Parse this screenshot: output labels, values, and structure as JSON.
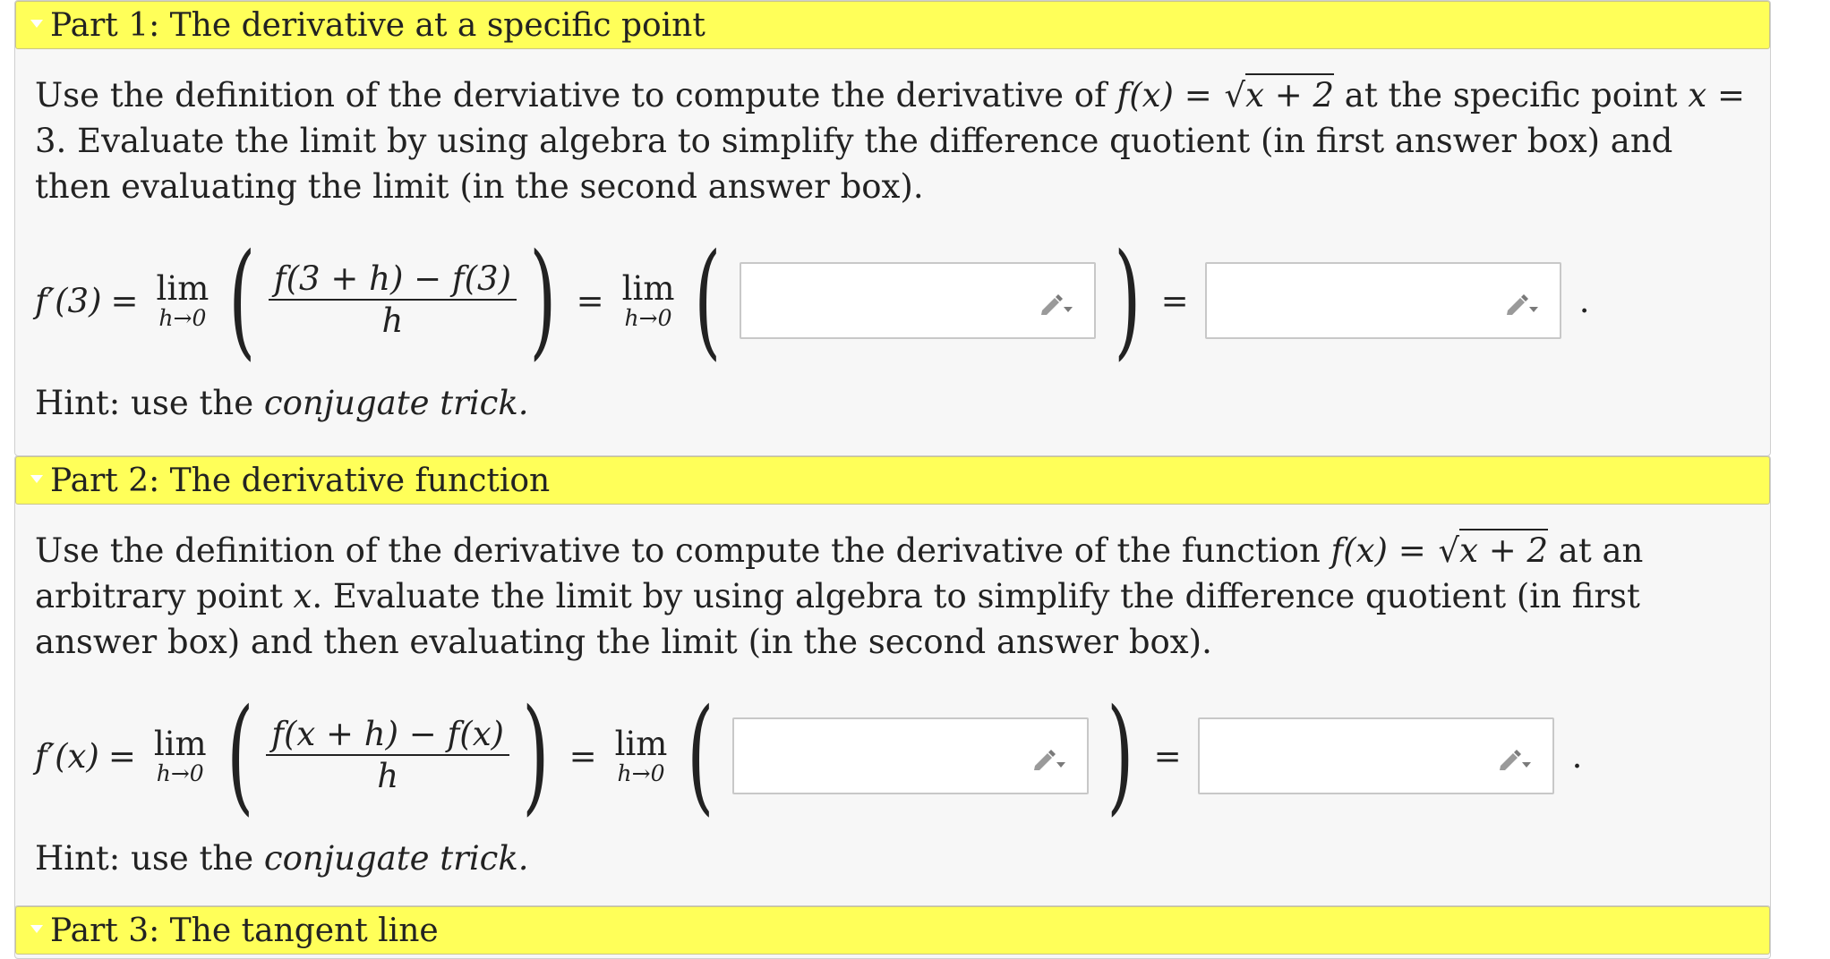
{
  "part1": {
    "title": "Part 1: The derivative at a specific point",
    "prompt_a": "Use the definition of the derviative to compute the derivative of ",
    "func_lhs": "f(x)",
    "func_eq": " = ",
    "func_sqrt": "x + 2",
    "prompt_b": " at the specific point ",
    "point_var": "x",
    "point_eq": " = ",
    "point_val": "3",
    "prompt_c": ". Evaluate the limit by using algebra to simplify the difference quotient (in first answer box) and then evaluating the limit (in the second answer box).",
    "eq_lhs": "f′(3)",
    "eq_equals": "=",
    "lim_word": "lim",
    "lim_sub": "h→0",
    "frac_num": "f(3 + h) − f(3)",
    "frac_den": "h",
    "answer1_value": "",
    "answer2_value": "",
    "trailing": ".",
    "hint_prefix": "Hint: use the ",
    "hint_em": "conjugate trick."
  },
  "part2": {
    "title": "Part 2: The derivative function",
    "prompt_a": "Use the definition of the derivative to compute the derivative of the function ",
    "func_lhs": "f(x)",
    "func_eq": " = ",
    "func_sqrt": "x + 2",
    "prompt_b": " at an arbitrary point ",
    "point_var": "x",
    "prompt_c": ". Evaluate the limit by using algebra to simplify the difference quotient (in first answer box) and then evaluating the limit (in the second answer box).",
    "eq_lhs": "f′(x)",
    "eq_equals": "=",
    "lim_word": "lim",
    "lim_sub": "h→0",
    "frac_num": "f(x + h) − f(x)",
    "frac_den": "h",
    "answer1_value": "",
    "answer2_value": "",
    "trailing": ".",
    "hint_prefix": "Hint: use the ",
    "hint_em": "conjugate trick."
  },
  "part3": {
    "title": "Part 3: The tangent line"
  },
  "colors": {
    "header_bg": "#ffff59",
    "section_bg": "#f7f7f7",
    "answer_border": "#c8c8c8",
    "pencil": "#8a8a8a"
  },
  "icons": [
    "collapse-triangle-icon",
    "pencil-dropdown-icon"
  ]
}
